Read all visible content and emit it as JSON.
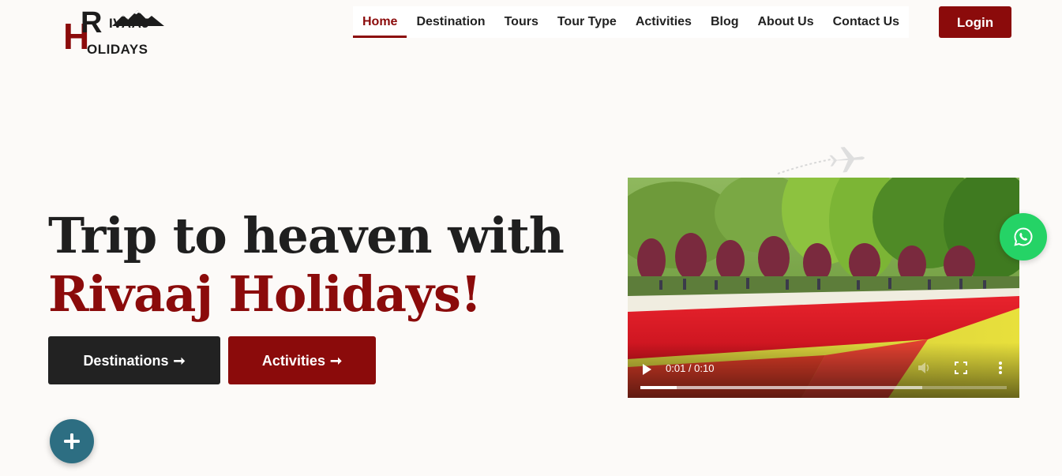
{
  "logo": {
    "letter_h": "H",
    "letter_r": "R",
    "word_top": "IVAAJ",
    "word_bottom": "OLIDAYS"
  },
  "nav": {
    "items": [
      {
        "label": "Home",
        "active": true
      },
      {
        "label": "Destination",
        "active": false
      },
      {
        "label": "Tours",
        "active": false
      },
      {
        "label": "Tour Type",
        "active": false
      },
      {
        "label": "Activities",
        "active": false
      },
      {
        "label": "Blog",
        "active": false
      },
      {
        "label": "About Us",
        "active": false
      },
      {
        "label": "Contact Us",
        "active": false
      }
    ],
    "login_label": "Login"
  },
  "hero": {
    "title_line1": "Trip to heaven with",
    "title_line2": "Rivaaj Holidays!",
    "buttons": {
      "destinations": "Destinations",
      "activities": "Activities",
      "arrow": "➞"
    }
  },
  "video": {
    "time": "0:01 / 0:10",
    "progress": 0.1,
    "buffered": 0.77
  },
  "colors": {
    "brand": "#8b0b0b",
    "dark": "#222222",
    "whatsapp": "#25d366",
    "fab": "#2d6e82",
    "background": "#fcfaf8"
  },
  "icons": {
    "floating_contact": "whatsapp-icon",
    "floating_action": "plus-icon",
    "video_play": "play-icon",
    "video_volume": "volume-icon",
    "video_fullscreen": "fullscreen-icon",
    "video_more": "more-vertical-icon",
    "decoration": "airplane-icon"
  }
}
